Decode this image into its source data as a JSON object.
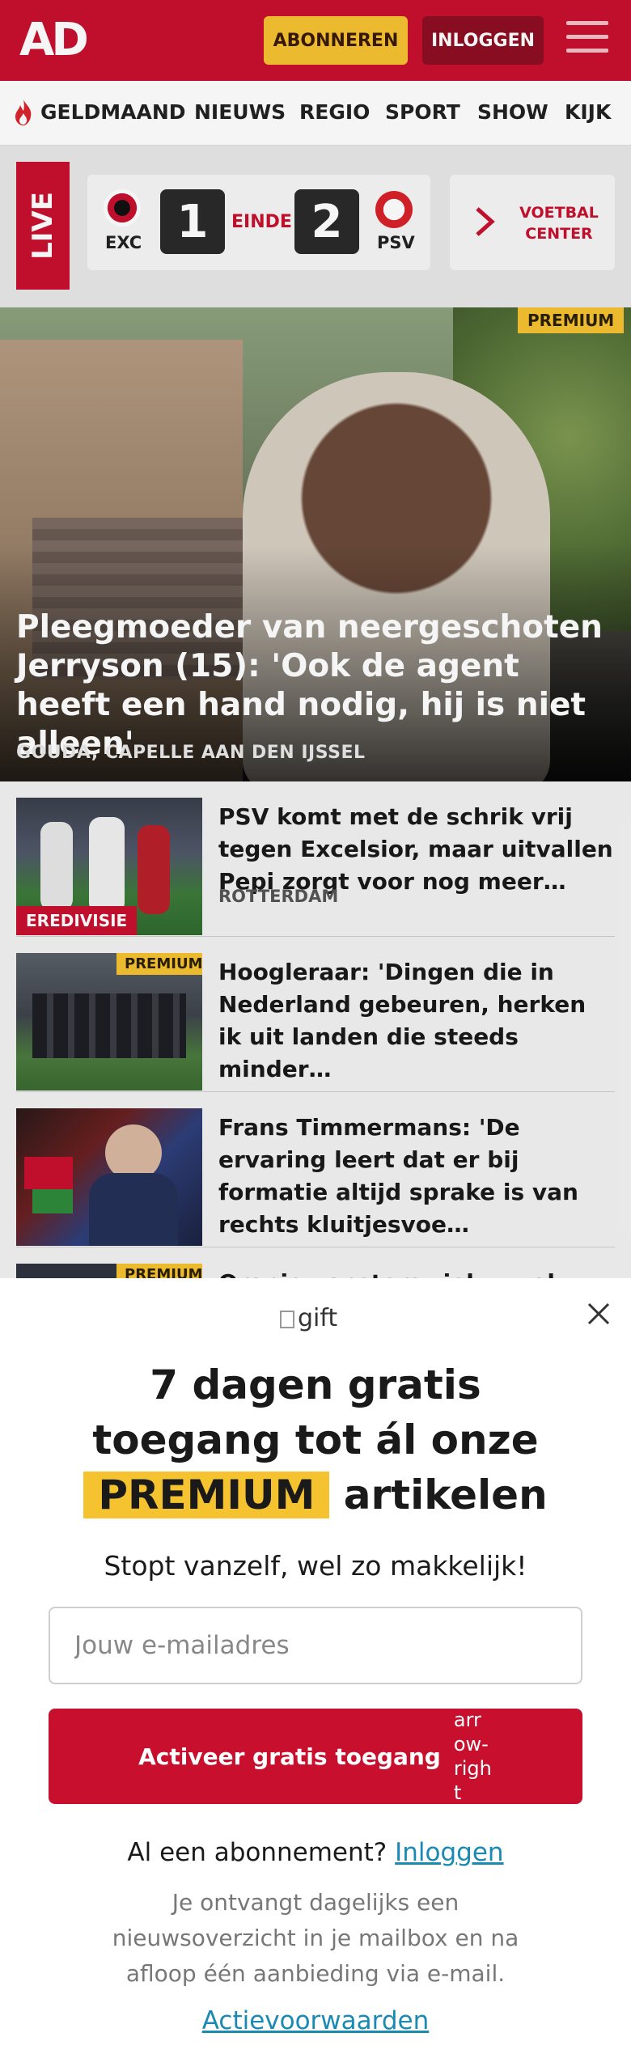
{
  "header": {
    "logo": "AD",
    "subscribe_label": "ABONNEREN",
    "login_label": "INLOGGEN"
  },
  "nav": {
    "items": [
      "GELDMAAND",
      "NIEUWS",
      "REGIO",
      "SPORT",
      "SHOW",
      "KIJK"
    ]
  },
  "live": {
    "badge": "LIVE",
    "home_team": "EXC",
    "away_team": "PSV",
    "home_score": "1",
    "away_score": "2",
    "status": "EINDE",
    "voetbal_center": "VOETBAL CENTER"
  },
  "hero": {
    "tag": "PREMIUM",
    "title": "Pleegmoeder van neergeschoten Jerryson (15): 'Ook de agent heeft een hand nodig, hij is niet alleen'",
    "location": "GOUDA, CAPELLE AAN DEN IJSSEL"
  },
  "articles": [
    {
      "tag": "EREDIVISIE",
      "title": "PSV komt met de schrik vrij tegen Excelsior, maar uitvallen Pepi zorgt voor nog meer…",
      "location": "ROTTERDAM"
    },
    {
      "tag": "PREMIUM",
      "title": "Hoogleraar: 'Dingen die in Nederland gebeuren, herken ik uit landen die steeds minder…",
      "location": ""
    },
    {
      "tag": "",
      "title": "Frans Timmermans: 'De ervaring leert dat er bij formatie altijd sprake is van rechts kluitjesvoe…",
      "location": ""
    },
    {
      "tag": "PREMIUM",
      "title": "Oranje-zonsters ziek, zwak en…",
      "location": ""
    }
  ],
  "modal": {
    "gift_alt": "gift",
    "title_line1": "7 dagen gratis",
    "title_line2": "toegang tot ál onze",
    "title_premium": "PREMIUM",
    "title_tail": "artikelen",
    "subtitle": "Stopt vanzelf, wel zo makkelijk!",
    "email_placeholder": "Jouw e-mailadres",
    "cta_label": "Activeer gratis toegang",
    "cta_arrow_alt": "arrow-right",
    "have_sub_text": "Al een abonnement?",
    "login_link": "Inloggen",
    "info": "Je ontvangt dagelijks een nieuwsoverzicht in je mailbox en na afloop één aanbieding via e-mail.",
    "terms_link": "Actievoorwaarden"
  },
  "colors": {
    "brand_red": "#c8102e",
    "premium_yellow": "#f5c230",
    "link_blue": "#1a8ab3"
  }
}
